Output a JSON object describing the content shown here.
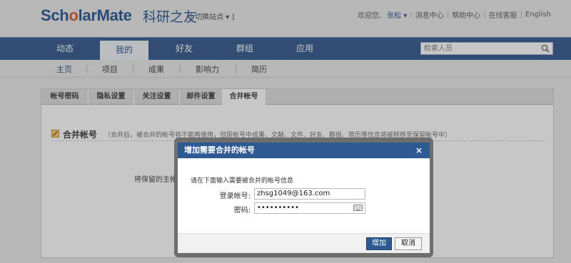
{
  "header": {
    "logo_part1": "Sch",
    "logo_part2": "o",
    "logo_part3": "larMate",
    "logo_cn": "科研之友",
    "site_switch": "[ 切换站点 ▾ ]",
    "welcome": "欢迎您,",
    "user": "张松 ▾",
    "links": [
      "消息中心",
      "帮助中心",
      "在线客服",
      "English"
    ]
  },
  "nav": {
    "items": [
      "动态",
      "我的",
      "好友",
      "群组",
      "应用"
    ],
    "active": "我的",
    "search_placeholder": "检索人员"
  },
  "subnav": {
    "items": [
      "主页",
      "项目",
      "成果",
      "影响力",
      "简历"
    ],
    "active": "主页"
  },
  "settings": {
    "tabs": [
      "帐号密码",
      "隐私设置",
      "关注设置",
      "邮件设置",
      "合并帐号"
    ],
    "active_tab": "合并帐号",
    "section_title": "合并帐号",
    "section_desc": "（合并后，被合并的帐号将不能再使用，但原帐号中成果、文献、文件、好友、群组、简历等信息将被转移至保留帐号中）",
    "keep_label": "将保留的主帐号"
  },
  "dialog": {
    "title": "增加需要合并的帐号",
    "close": "×",
    "intro": "请在下面输入需要被合并的帐号信息",
    "account_label": "登录帐号:",
    "account_value": "zhsg1049@163.com",
    "password_label": "密码:",
    "password_value": "••••••••••",
    "add_button": "增加",
    "cancel_button": "取消"
  },
  "colors": {
    "brand_blue": "#2a5188",
    "brand_orange": "#d9561c",
    "dialog_header": "#2d5a92"
  }
}
